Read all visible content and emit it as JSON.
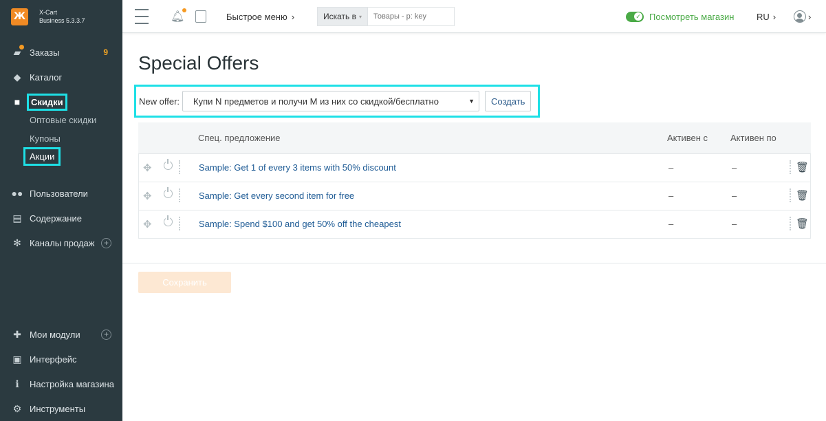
{
  "brand": {
    "logo_glyph": "Ж",
    "name": "X-Cart",
    "edition": "Business 5.3.3.7"
  },
  "sidebar": {
    "items": [
      {
        "key": "orders",
        "label": "Заказы",
        "badge": "9",
        "icon": "orders-icon"
      },
      {
        "key": "catalog",
        "label": "Каталог",
        "icon": "tag-icon"
      },
      {
        "key": "discounts",
        "label": "Скидки",
        "icon": "gift-icon"
      },
      {
        "key": "users",
        "label": "Пользователи",
        "icon": "users-icon"
      },
      {
        "key": "content",
        "label": "Содержание",
        "icon": "content-icon"
      },
      {
        "key": "channels",
        "label": "Каналы продаж",
        "icon": "channels-icon"
      },
      {
        "key": "modules",
        "label": "Мои модули",
        "icon": "puzzle-icon"
      },
      {
        "key": "interface",
        "label": "Интерфейс",
        "icon": "image-icon"
      },
      {
        "key": "store_settings",
        "label": "Настройка магазина",
        "icon": "info-icon"
      },
      {
        "key": "tools",
        "label": "Инструменты",
        "icon": "gear-icon"
      }
    ],
    "discount_subitems": [
      {
        "label": "Оптовые скидки"
      },
      {
        "label": "Купоны"
      },
      {
        "label": "Акции"
      }
    ]
  },
  "topbar": {
    "quick_menu": "Быстрое меню",
    "search_in": "Искать в",
    "search_placeholder": "Товары - p: key",
    "view_store": "Посмотреть магазин",
    "lang": "RU"
  },
  "main": {
    "title": "Special Offers",
    "new_offer_label": "New offer:",
    "new_offer_selected": "Купи N предметов и получи M из них со скидкой/бесплатно",
    "create_label": "Создать",
    "columns": [
      "Спец. предложение",
      "Активен с",
      "Активен по"
    ],
    "rows": [
      {
        "name": "Sample: Get 1 of every 3 items with 50% discount",
        "active_from": "–",
        "active_to": "–"
      },
      {
        "name": "Sample: Get every second item for free",
        "active_from": "–",
        "active_to": "–"
      },
      {
        "name": "Sample: Spend $100 and get 50% off the cheapest",
        "active_from": "–",
        "active_to": "–"
      }
    ],
    "save_label": "Сохранить"
  },
  "colors": {
    "sidebar_bg": "#2b3a40",
    "accent_orange": "#f08a24",
    "highlight": "#1ee0e6",
    "link": "#1e5b95",
    "green": "#4aaa46"
  }
}
